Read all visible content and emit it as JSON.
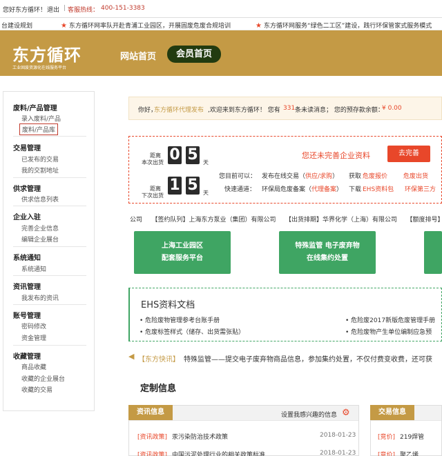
{
  "topbar": {
    "greeting": "您好东方循环！",
    "logout": "退出",
    "hotline_label": "客服热线：",
    "hotline_number": "400-151-3383"
  },
  "ticker": {
    "items": [
      "台建设规划",
      "东方循环网率队开赴青浦工业园区，开展固废危废合规培训",
      "东方循环网服务“绿色二工区”建设，践行环保管家式服务模式"
    ]
  },
  "header": {
    "logo_text": "东方循环",
    "logo_subtitle": "工业固废资源化在线服务平台",
    "nav_home": "网站首页",
    "nav_member": "会员首页"
  },
  "sidebar": {
    "sections": [
      {
        "title": "废料/产品管理",
        "items": [
          "录入废料/产品",
          "废料/产品库"
        ]
      },
      {
        "title": "交易管理",
        "items": [
          "已发布的交易",
          "我的交割地址"
        ]
      },
      {
        "title": "供求管理",
        "items": [
          "供求信息列表"
        ]
      },
      {
        "title": "企业入驻",
        "items": [
          "完善企业信息",
          "编辑企业展台"
        ]
      },
      {
        "title": "系统通知",
        "items": [
          "系统通知"
        ]
      },
      {
        "title": "资讯管理",
        "items": [
          "我发布的资讯"
        ]
      },
      {
        "title": "账号管理",
        "items": [
          "密码修改",
          "资金管理"
        ]
      },
      {
        "title": "收藏管理",
        "items": [
          "商品收藏",
          "收藏的企业展台",
          "收藏的交易"
        ]
      }
    ]
  },
  "notice": {
    "hello": "你好，",
    "company": "东方循环代理发布",
    "welcome": ",欢迎来到东方循环！ 您有",
    "unread_count": "331",
    "unread_suffix": "条未读消息； 您的预存款余额：",
    "balance": "¥ 0.00"
  },
  "countdown": {
    "label1a": "距离",
    "label1b": "本次出货",
    "digits1": [
      "0",
      "5"
    ],
    "unit": "天",
    "label2a": "距离",
    "label2b": "下次出货",
    "digits2": [
      "1",
      "5"
    ]
  },
  "profile": {
    "incomplete_text": "您还未完善企业资料",
    "complete_button": "去完善"
  },
  "actions": {
    "row1_label": "您目前可以：",
    "row1_item1": "发布在线交易（",
    "row1_link1": "供应/求购",
    "row1_item1_end": "）",
    "row1_item2": "获取",
    "row1_link2": "危废报价",
    "row1_link3": "危废出货",
    "row2_label": "快速通道：",
    "row2_item1": "环保局危废备案（",
    "row2_link1": "代理备案",
    "row2_item1_end": "）",
    "row2_item2": "下载",
    "row2_link2": "EHS资料包",
    "row2_link3": "环保第三方"
  },
  "records": {
    "text": "公司　　【签约队列】上海东方泵业（集团）有限公司　　【出货排期】华界化学（上海）有限公司　　【额度排号】"
  },
  "green_buttons": [
    {
      "line1": "上海工业园区",
      "line2": "配套服务平台"
    },
    {
      "line1": "特殊监管 电子废弃物",
      "line2": "在线集约处置"
    }
  ],
  "ehs": {
    "title": "EHS资料文档",
    "left_items": [
      "危险废物管理参考台账手册",
      "危废标签样式（储存、出货需张贴）"
    ],
    "right_items": [
      "危险废2017新版危废管理手册",
      "危险废物产生单位编制应急预"
    ]
  },
  "flash": {
    "tag": "【东方快讯】",
    "text": "特殊监管——提交电子废弃物商品信息，参加集约处置，不仅付费变收费，还可获"
  },
  "custom_info": {
    "title": "定制信息"
  },
  "info_card": {
    "tag": "资讯信息",
    "settings_link": "设置我感兴趣的信息",
    "rows": [
      {
        "category": "[资讯政策]",
        "title": "汞污染防治技术政策",
        "date": "2018-01-23"
      },
      {
        "category": "[资讯政策]",
        "title": "中国污泥处理行业的相关政策标准",
        "date": "2018-01-23"
      }
    ]
  },
  "trade_card": {
    "tag": "交易信息",
    "rows": [
      {
        "category": "[竞价]",
        "title": "219焊管"
      },
      {
        "category": "[竞价]",
        "title": "聚乙烯"
      }
    ]
  },
  "colors": {
    "brand_gold": "#c49a45",
    "nav_dark": "#223b10",
    "accent_orange": "#e8472a",
    "green": "#3fa563"
  }
}
